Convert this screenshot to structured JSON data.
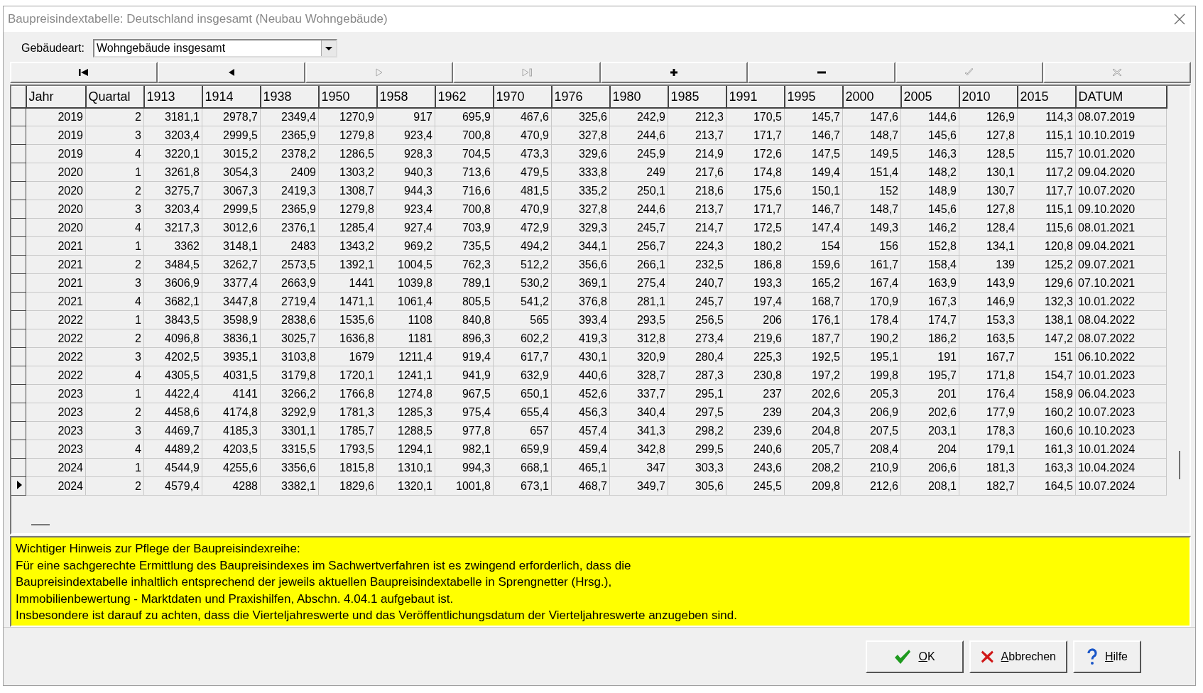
{
  "window": {
    "title": "Baupreisindextabelle: Deutschland insgesamt (Neubau Wohngebäude)"
  },
  "building_type": {
    "label": "Gebäudeart:",
    "value": "Wohngebäude insgesamt"
  },
  "navigator": [
    {
      "kind": "first",
      "disabled": false
    },
    {
      "kind": "prior",
      "disabled": false
    },
    {
      "kind": "next",
      "disabled": true
    },
    {
      "kind": "last",
      "disabled": true
    },
    {
      "kind": "insert",
      "disabled": false
    },
    {
      "kind": "delete",
      "disabled": false
    },
    {
      "kind": "post",
      "disabled": true
    },
    {
      "kind": "cancel",
      "disabled": true
    }
  ],
  "table": {
    "columns": [
      "Jahr",
      "Quartal",
      "1913",
      "1914",
      "1938",
      "1950",
      "1958",
      "1962",
      "1970",
      "1976",
      "1980",
      "1985",
      "1991",
      "1995",
      "2000",
      "2005",
      "2010",
      "2015",
      "DATUM"
    ],
    "rows": [
      {
        "selected": false,
        "cells": [
          "2019",
          "2",
          "3181,1",
          "2978,7",
          "2349,4",
          "1270,9",
          "917",
          "695,9",
          "467,6",
          "325,6",
          "242,9",
          "212,3",
          "170,5",
          "145,7",
          "147,6",
          "144,6",
          "126,9",
          "114,3",
          "08.07.2019"
        ]
      },
      {
        "selected": false,
        "cells": [
          "2019",
          "3",
          "3203,4",
          "2999,5",
          "2365,9",
          "1279,8",
          "923,4",
          "700,8",
          "470,9",
          "327,8",
          "244,6",
          "213,7",
          "171,7",
          "146,7",
          "148,7",
          "145,6",
          "127,8",
          "115,1",
          "10.10.2019"
        ]
      },
      {
        "selected": false,
        "cells": [
          "2019",
          "4",
          "3220,1",
          "3015,2",
          "2378,2",
          "1286,5",
          "928,3",
          "704,5",
          "473,3",
          "329,6",
          "245,9",
          "214,9",
          "172,6",
          "147,5",
          "149,5",
          "146,3",
          "128,5",
          "115,7",
          "10.01.2020"
        ]
      },
      {
        "selected": false,
        "cells": [
          "2020",
          "1",
          "3261,8",
          "3054,3",
          "2409",
          "1303,2",
          "940,3",
          "713,6",
          "479,5",
          "333,8",
          "249",
          "217,6",
          "174,8",
          "149,4",
          "151,4",
          "148,2",
          "130,1",
          "117,2",
          "09.04.2020"
        ]
      },
      {
        "selected": false,
        "cells": [
          "2020",
          "2",
          "3275,7",
          "3067,3",
          "2419,3",
          "1308,7",
          "944,3",
          "716,6",
          "481,5",
          "335,2",
          "250,1",
          "218,6",
          "175,6",
          "150,1",
          "152",
          "148,9",
          "130,7",
          "117,7",
          "10.07.2020"
        ]
      },
      {
        "selected": false,
        "cells": [
          "2020",
          "3",
          "3203,4",
          "2999,5",
          "2365,9",
          "1279,8",
          "923,4",
          "700,8",
          "470,9",
          "327,8",
          "244,6",
          "213,7",
          "171,7",
          "146,7",
          "148,7",
          "145,6",
          "127,8",
          "115,1",
          "09.10.2020"
        ]
      },
      {
        "selected": false,
        "cells": [
          "2020",
          "4",
          "3217,3",
          "3012,6",
          "2376,1",
          "1285,4",
          "927,4",
          "703,9",
          "472,9",
          "329,3",
          "245,7",
          "214,7",
          "172,5",
          "147,4",
          "149,3",
          "146,2",
          "128,4",
          "115,6",
          "08.01.2021"
        ]
      },
      {
        "selected": false,
        "cells": [
          "2021",
          "1",
          "3362",
          "3148,1",
          "2483",
          "1343,2",
          "969,2",
          "735,5",
          "494,2",
          "344,1",
          "256,7",
          "224,3",
          "180,2",
          "154",
          "156",
          "152,8",
          "134,1",
          "120,8",
          "09.04.2021"
        ]
      },
      {
        "selected": false,
        "cells": [
          "2021",
          "2",
          "3484,5",
          "3262,7",
          "2573,5",
          "1392,1",
          "1004,5",
          "762,3",
          "512,2",
          "356,6",
          "266,1",
          "232,5",
          "186,8",
          "159,6",
          "161,7",
          "158,4",
          "139",
          "125,2",
          "09.07.2021"
        ]
      },
      {
        "selected": false,
        "cells": [
          "2021",
          "3",
          "3606,9",
          "3377,4",
          "2663,9",
          "1441",
          "1039,8",
          "789,1",
          "530,2",
          "369,1",
          "275,4",
          "240,7",
          "193,3",
          "165,2",
          "167,4",
          "163,9",
          "143,9",
          "129,6",
          "07.10.2021"
        ]
      },
      {
        "selected": false,
        "cells": [
          "2021",
          "4",
          "3682,1",
          "3447,8",
          "2719,4",
          "1471,1",
          "1061,4",
          "805,5",
          "541,2",
          "376,8",
          "281,1",
          "245,7",
          "197,4",
          "168,7",
          "170,9",
          "167,3",
          "146,9",
          "132,3",
          "10.01.2022"
        ]
      },
      {
        "selected": false,
        "cells": [
          "2022",
          "1",
          "3843,5",
          "3598,9",
          "2838,6",
          "1535,6",
          "1108",
          "840,8",
          "565",
          "393,4",
          "293,5",
          "256,5",
          "206",
          "176,1",
          "178,4",
          "174,7",
          "153,3",
          "138,1",
          "08.04.2022"
        ]
      },
      {
        "selected": false,
        "cells": [
          "2022",
          "2",
          "4096,8",
          "3836,1",
          "3025,7",
          "1636,8",
          "1181",
          "896,3",
          "602,2",
          "419,3",
          "312,8",
          "273,4",
          "219,6",
          "187,7",
          "190,2",
          "186,2",
          "163,5",
          "147,2",
          "08.07.2022"
        ]
      },
      {
        "selected": false,
        "cells": [
          "2022",
          "3",
          "4202,5",
          "3935,1",
          "3103,8",
          "1679",
          "1211,4",
          "919,4",
          "617,7",
          "430,1",
          "320,9",
          "280,4",
          "225,3",
          "192,5",
          "195,1",
          "191",
          "167,7",
          "151",
          "06.10.2022"
        ]
      },
      {
        "selected": false,
        "cells": [
          "2022",
          "4",
          "4305,5",
          "4031,5",
          "3179,8",
          "1720,1",
          "1241,1",
          "941,9",
          "632,9",
          "440,6",
          "328,7",
          "287,3",
          "230,8",
          "197,2",
          "199,8",
          "195,7",
          "171,8",
          "154,7",
          "10.01.2023"
        ]
      },
      {
        "selected": false,
        "cells": [
          "2023",
          "1",
          "4422,4",
          "4141",
          "3266,2",
          "1766,8",
          "1274,8",
          "967,5",
          "650,1",
          "452,6",
          "337,7",
          "295,1",
          "237",
          "202,6",
          "205,3",
          "201",
          "176,4",
          "158,9",
          "06.04.2023"
        ]
      },
      {
        "selected": false,
        "cells": [
          "2023",
          "2",
          "4458,6",
          "4174,8",
          "3292,9",
          "1781,3",
          "1285,3",
          "975,4",
          "655,4",
          "456,3",
          "340,4",
          "297,5",
          "239",
          "204,3",
          "206,9",
          "202,6",
          "177,9",
          "160,2",
          "10.07.2023"
        ]
      },
      {
        "selected": false,
        "cells": [
          "2023",
          "3",
          "4469,7",
          "4185,3",
          "3301,1",
          "1785,7",
          "1288,5",
          "977,8",
          "657",
          "457,4",
          "341,3",
          "298,2",
          "239,6",
          "204,8",
          "207,5",
          "203,1",
          "178,3",
          "160,6",
          "10.10.2023"
        ]
      },
      {
        "selected": false,
        "cells": [
          "2023",
          "4",
          "4489,2",
          "4203,5",
          "3315,5",
          "1793,5",
          "1294,1",
          "982,1",
          "659,9",
          "459,4",
          "342,8",
          "299,5",
          "240,6",
          "205,7",
          "208,4",
          "204",
          "179,1",
          "161,3",
          "10.01.2024"
        ]
      },
      {
        "selected": false,
        "cells": [
          "2024",
          "1",
          "4544,9",
          "4255,6",
          "3356,6",
          "1815,8",
          "1310,1",
          "994,3",
          "668,1",
          "465,1",
          "347",
          "303,3",
          "243,6",
          "208,2",
          "210,9",
          "206,6",
          "181,3",
          "163,3",
          "10.04.2024"
        ]
      },
      {
        "selected": true,
        "cells": [
          "2024",
          "2",
          "4579,4",
          "4288",
          "3382,1",
          "1829,6",
          "1320,1",
          "1001,8",
          "673,1",
          "468,7",
          "349,7",
          "305,6",
          "245,5",
          "209,8",
          "212,6",
          "208,1",
          "182,7",
          "164,5",
          "10.07.2024"
        ]
      }
    ]
  },
  "notice": [
    "Wichtiger Hinweis zur Pflege der Baupreisindexreihe:",
    "Für eine sachgerechte Ermittlung des Baupreisindexes im Sachwertverfahren ist es zwingend erforderlich, dass die",
    "Baupreisindextabelle inhaltlich entsprechend der jeweils aktuellen Baupreisindextabelle in Sprengnetter (Hrsg.),",
    "Immobilienbewertung - Marktdaten und Praxishilfen, Abschn. 4.04.1 aufgebaut ist.",
    "Insbesondere ist darauf zu achten, dass die Vierteljahreswerte und das Veröffentlichungsdatum der Vierteljahreswerte anzugeben sind."
  ],
  "buttons": [
    {
      "kind": "ok",
      "label": "OK"
    },
    {
      "kind": "cancel",
      "label": "Abbrechen"
    },
    {
      "kind": "help",
      "label": "Hilfe"
    }
  ]
}
